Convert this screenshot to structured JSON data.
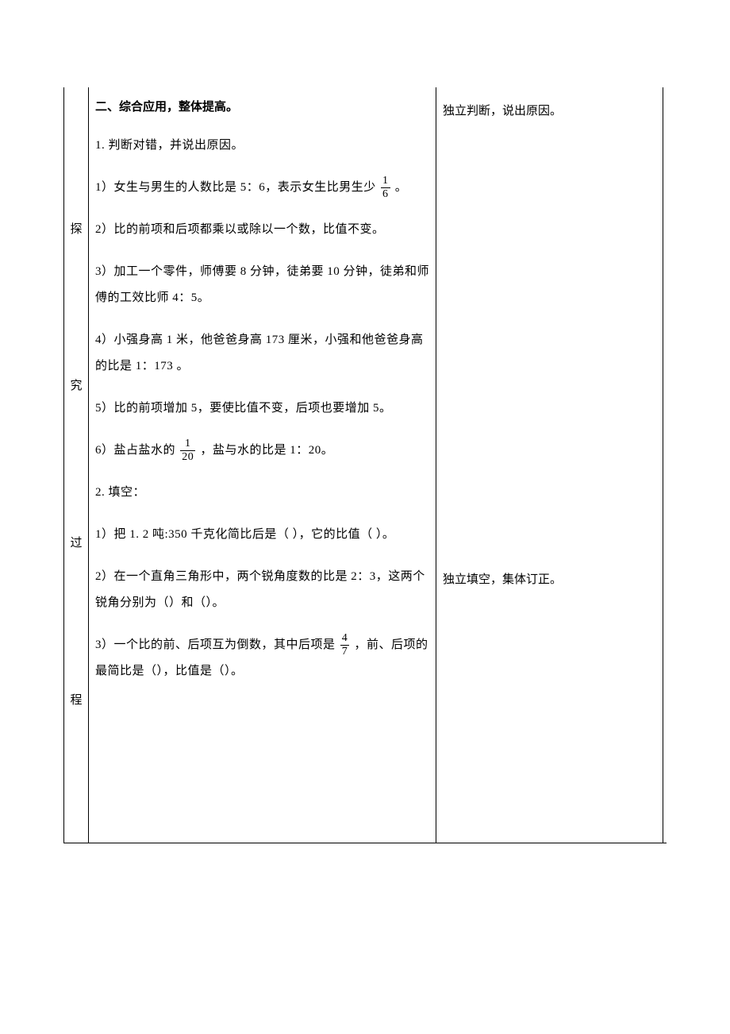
{
  "labelChars": {
    "c1": "探",
    "c2": "究",
    "c3": "过",
    "c4": "程"
  },
  "section2": {
    "title": "二、综合应用，整体提高。",
    "judge": {
      "lead": "1. 判断对错，并说出原因。",
      "q1_a": "1）女生与男生的人数比是 5：6，表示女生比男生少",
      "q1_b": "。",
      "q2": "2）比的前项和后项都乘以或除以一个数，比值不变。",
      "q3": "3）加工一个零件，师傅要 8 分钟，徒弟要 10 分钟，徒弟和师傅的工效比师 4：5。",
      "q4": "4）小强身高 1 米，他爸爸身高 173 厘米，小强和他爸爸身高的比是 1：173 。",
      "q5": "5）比的前项增加 5，要使比值不变，后项也要增加 5。",
      "q6_a": "6）盐占盐水的 ",
      "q6_b": " ，盐与水的比是 1：20。"
    },
    "fill": {
      "lead": "2. 填空：",
      "q1": "1）把 1. 2 吨:350 千克化简比后是（   ），它的比值（   ）。",
      "q2": "2）在一个直角三角形中，两个锐角度数的比是 2：3，这两个锐角分别为（）和（）。",
      "q3_a": "3）一个比的前、后项互为倒数，其中后项是",
      "q3_b": "，前、后项的最简比是（），比值是（）。"
    },
    "fracs": {
      "oneSixth": {
        "num": "1",
        "den": "6"
      },
      "oneTwentieth": {
        "num": "1",
        "den": "20"
      },
      "fourSevenths": {
        "num": "4",
        "den": "7"
      }
    }
  },
  "rightCol": {
    "topNote": "独立判断，说出原因。",
    "bottomNote": "独立填空，集体订正。"
  }
}
